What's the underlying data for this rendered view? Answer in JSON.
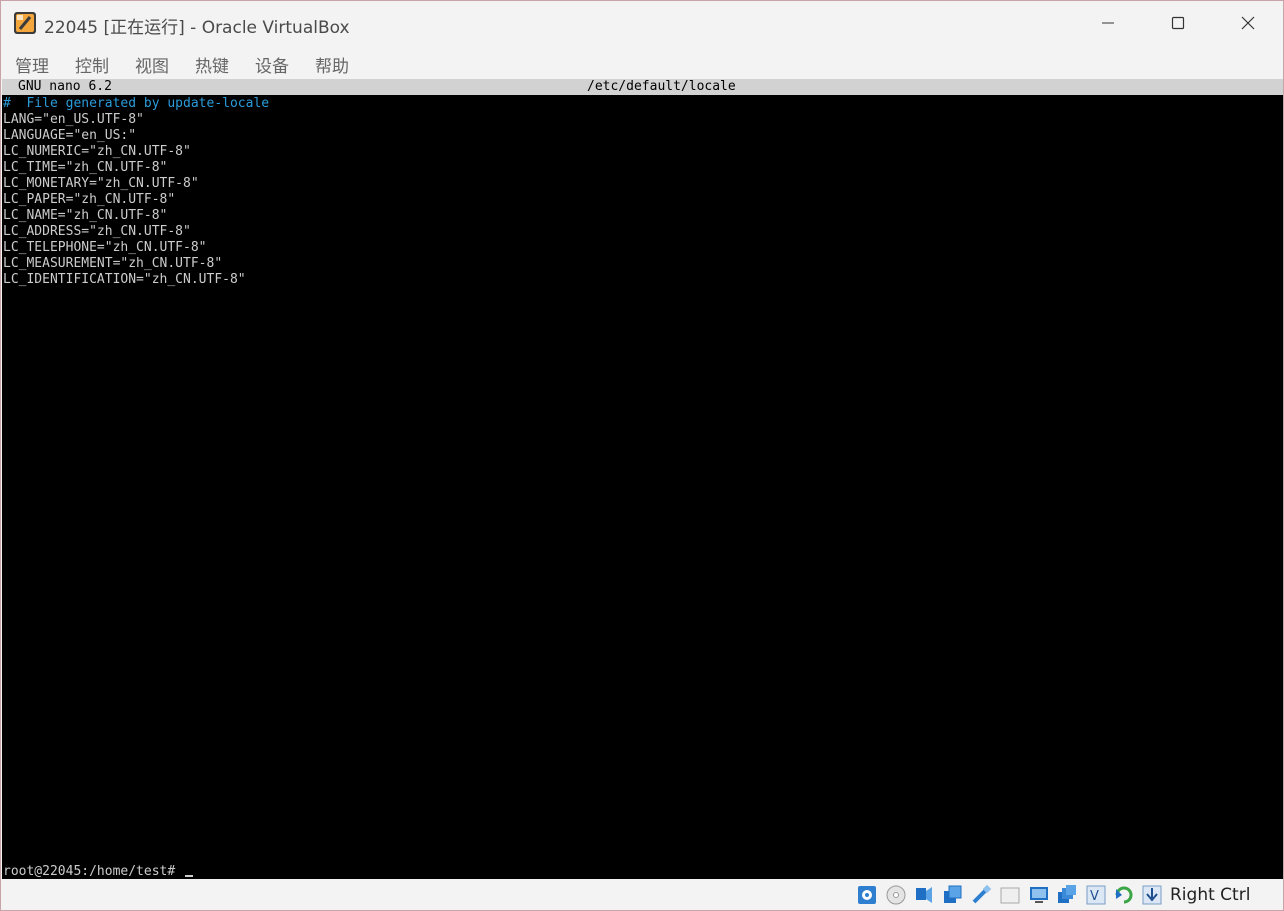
{
  "window": {
    "title": "22045 [正在运行] - Oracle VirtualBox"
  },
  "menu": [
    {
      "label": "管理"
    },
    {
      "label": "控制"
    },
    {
      "label": "视图"
    },
    {
      "label": "热键"
    },
    {
      "label": "设备"
    },
    {
      "label": "帮助"
    }
  ],
  "nano": {
    "version": "GNU nano 6.2",
    "filename": "/etc/default/locale",
    "lines": [
      {
        "text": "#  File generated by update-locale",
        "type": "comment"
      },
      {
        "text": "LANG=\"en_US.UTF-8\"",
        "type": "text"
      },
      {
        "text": "LANGUAGE=\"en_US:\"",
        "type": "text"
      },
      {
        "text": "LC_NUMERIC=\"zh_CN.UTF-8\"",
        "type": "text"
      },
      {
        "text": "LC_TIME=\"zh_CN.UTF-8\"",
        "type": "text"
      },
      {
        "text": "LC_MONETARY=\"zh_CN.UTF-8\"",
        "type": "text"
      },
      {
        "text": "LC_PAPER=\"zh_CN.UTF-8\"",
        "type": "text"
      },
      {
        "text": "LC_NAME=\"zh_CN.UTF-8\"",
        "type": "text"
      },
      {
        "text": "LC_ADDRESS=\"zh_CN.UTF-8\"",
        "type": "text"
      },
      {
        "text": "LC_TELEPHONE=\"zh_CN.UTF-8\"",
        "type": "text"
      },
      {
        "text": "LC_MEASUREMENT=\"zh_CN.UTF-8\"",
        "type": "text"
      },
      {
        "text": "LC_IDENTIFICATION=\"zh_CN.UTF-8\"",
        "type": "text"
      }
    ]
  },
  "terminal": {
    "prompt": "root@22045:/home/test# "
  },
  "statusbar": {
    "icons": [
      "hard-disk-icon",
      "optical-drive-icon",
      "audio-icon",
      "network-icon",
      "usb-icon",
      "shared-folders-icon",
      "display-icon",
      "recording-icon",
      "virtualization-icon",
      "mouse-integration-icon",
      "keyboard-capture-icon"
    ],
    "host_key": "Right Ctrl"
  },
  "colors": {
    "titlebar_bg": "#f3f3f3",
    "terminal_bg": "#000000",
    "terminal_fg": "#cccccc",
    "comment": "#2b9bd9",
    "nano_header_bg": "#d2d2d2"
  }
}
